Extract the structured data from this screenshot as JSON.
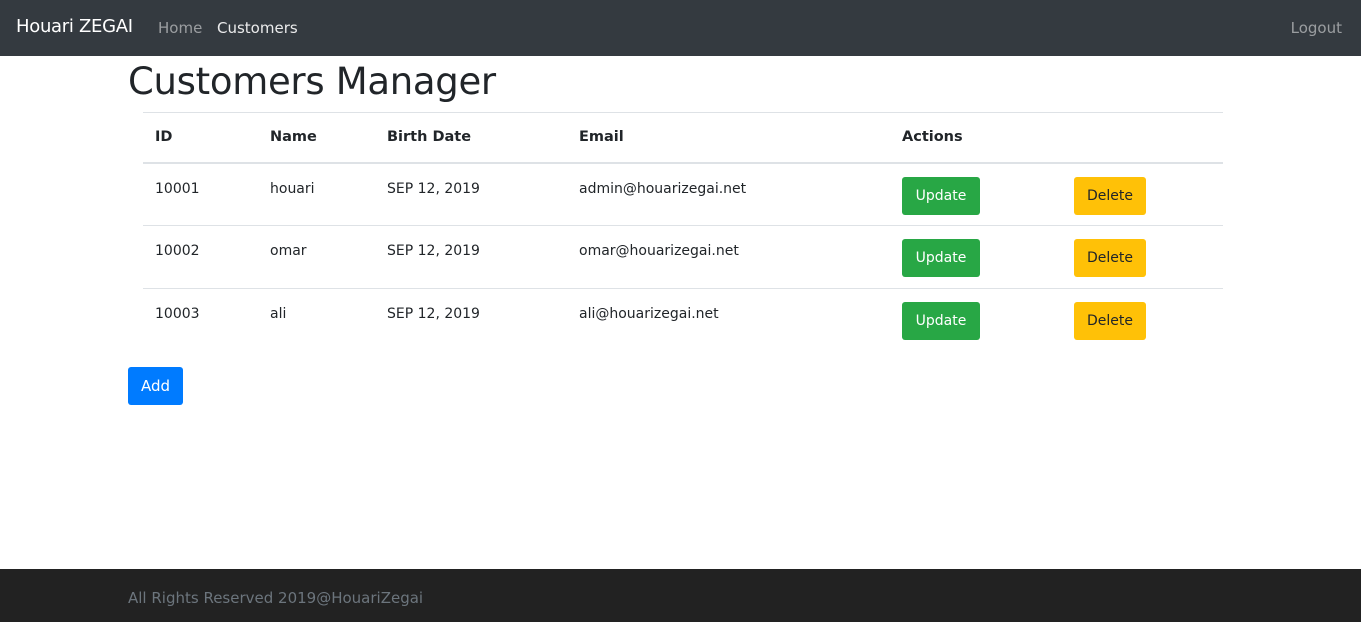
{
  "navbar": {
    "brand": "Houari ZEGAI",
    "links": [
      {
        "label": "Home",
        "active": false
      },
      {
        "label": "Customers",
        "active": true
      }
    ],
    "logout": "Logout"
  },
  "page": {
    "title": "Customers Manager"
  },
  "table": {
    "headers": [
      "ID",
      "Name",
      "Birth Date",
      "Email",
      "Actions",
      ""
    ],
    "rows": [
      {
        "id": "10001",
        "name": "houari",
        "birth_date": "SEP 12, 2019",
        "email": "admin@houarizegai.net",
        "update": "Update",
        "delete": "Delete"
      },
      {
        "id": "10002",
        "name": "omar",
        "birth_date": "SEP 12, 2019",
        "email": "omar@houarizegai.net",
        "update": "Update",
        "delete": "Delete"
      },
      {
        "id": "10003",
        "name": "ali",
        "birth_date": "SEP 12, 2019",
        "email": "ali@houarizegai.net",
        "update": "Update",
        "delete": "Delete"
      }
    ]
  },
  "add_button": "Add",
  "footer": {
    "text": "All Rights Reserved 2019@HouariZegai"
  },
  "colors": {
    "navbar_bg": "#343a40",
    "footer_bg": "#222222",
    "success": "#28a745",
    "warning": "#ffc107",
    "primary": "#007bff"
  }
}
